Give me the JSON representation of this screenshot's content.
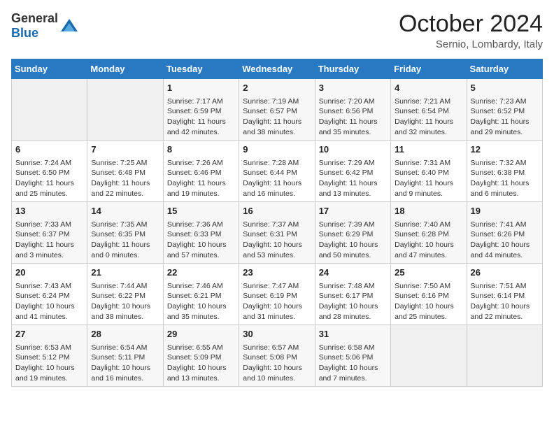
{
  "header": {
    "logo_general": "General",
    "logo_blue": "Blue",
    "month": "October 2024",
    "location": "Sernio, Lombardy, Italy"
  },
  "weekdays": [
    "Sunday",
    "Monday",
    "Tuesday",
    "Wednesday",
    "Thursday",
    "Friday",
    "Saturday"
  ],
  "weeks": [
    [
      {
        "day": "",
        "sunrise": "",
        "sunset": "",
        "daylight": ""
      },
      {
        "day": "",
        "sunrise": "",
        "sunset": "",
        "daylight": ""
      },
      {
        "day": "1",
        "sunrise": "Sunrise: 7:17 AM",
        "sunset": "Sunset: 6:59 PM",
        "daylight": "Daylight: 11 hours and 42 minutes."
      },
      {
        "day": "2",
        "sunrise": "Sunrise: 7:19 AM",
        "sunset": "Sunset: 6:57 PM",
        "daylight": "Daylight: 11 hours and 38 minutes."
      },
      {
        "day": "3",
        "sunrise": "Sunrise: 7:20 AM",
        "sunset": "Sunset: 6:56 PM",
        "daylight": "Daylight: 11 hours and 35 minutes."
      },
      {
        "day": "4",
        "sunrise": "Sunrise: 7:21 AM",
        "sunset": "Sunset: 6:54 PM",
        "daylight": "Daylight: 11 hours and 32 minutes."
      },
      {
        "day": "5",
        "sunrise": "Sunrise: 7:23 AM",
        "sunset": "Sunset: 6:52 PM",
        "daylight": "Daylight: 11 hours and 29 minutes."
      }
    ],
    [
      {
        "day": "6",
        "sunrise": "Sunrise: 7:24 AM",
        "sunset": "Sunset: 6:50 PM",
        "daylight": "Daylight: 11 hours and 25 minutes."
      },
      {
        "day": "7",
        "sunrise": "Sunrise: 7:25 AM",
        "sunset": "Sunset: 6:48 PM",
        "daylight": "Daylight: 11 hours and 22 minutes."
      },
      {
        "day": "8",
        "sunrise": "Sunrise: 7:26 AM",
        "sunset": "Sunset: 6:46 PM",
        "daylight": "Daylight: 11 hours and 19 minutes."
      },
      {
        "day": "9",
        "sunrise": "Sunrise: 7:28 AM",
        "sunset": "Sunset: 6:44 PM",
        "daylight": "Daylight: 11 hours and 16 minutes."
      },
      {
        "day": "10",
        "sunrise": "Sunrise: 7:29 AM",
        "sunset": "Sunset: 6:42 PM",
        "daylight": "Daylight: 11 hours and 13 minutes."
      },
      {
        "day": "11",
        "sunrise": "Sunrise: 7:31 AM",
        "sunset": "Sunset: 6:40 PM",
        "daylight": "Daylight: 11 hours and 9 minutes."
      },
      {
        "day": "12",
        "sunrise": "Sunrise: 7:32 AM",
        "sunset": "Sunset: 6:38 PM",
        "daylight": "Daylight: 11 hours and 6 minutes."
      }
    ],
    [
      {
        "day": "13",
        "sunrise": "Sunrise: 7:33 AM",
        "sunset": "Sunset: 6:37 PM",
        "daylight": "Daylight: 11 hours and 3 minutes."
      },
      {
        "day": "14",
        "sunrise": "Sunrise: 7:35 AM",
        "sunset": "Sunset: 6:35 PM",
        "daylight": "Daylight: 11 hours and 0 minutes."
      },
      {
        "day": "15",
        "sunrise": "Sunrise: 7:36 AM",
        "sunset": "Sunset: 6:33 PM",
        "daylight": "Daylight: 10 hours and 57 minutes."
      },
      {
        "day": "16",
        "sunrise": "Sunrise: 7:37 AM",
        "sunset": "Sunset: 6:31 PM",
        "daylight": "Daylight: 10 hours and 53 minutes."
      },
      {
        "day": "17",
        "sunrise": "Sunrise: 7:39 AM",
        "sunset": "Sunset: 6:29 PM",
        "daylight": "Daylight: 10 hours and 50 minutes."
      },
      {
        "day": "18",
        "sunrise": "Sunrise: 7:40 AM",
        "sunset": "Sunset: 6:28 PM",
        "daylight": "Daylight: 10 hours and 47 minutes."
      },
      {
        "day": "19",
        "sunrise": "Sunrise: 7:41 AM",
        "sunset": "Sunset: 6:26 PM",
        "daylight": "Daylight: 10 hours and 44 minutes."
      }
    ],
    [
      {
        "day": "20",
        "sunrise": "Sunrise: 7:43 AM",
        "sunset": "Sunset: 6:24 PM",
        "daylight": "Daylight: 10 hours and 41 minutes."
      },
      {
        "day": "21",
        "sunrise": "Sunrise: 7:44 AM",
        "sunset": "Sunset: 6:22 PM",
        "daylight": "Daylight: 10 hours and 38 minutes."
      },
      {
        "day": "22",
        "sunrise": "Sunrise: 7:46 AM",
        "sunset": "Sunset: 6:21 PM",
        "daylight": "Daylight: 10 hours and 35 minutes."
      },
      {
        "day": "23",
        "sunrise": "Sunrise: 7:47 AM",
        "sunset": "Sunset: 6:19 PM",
        "daylight": "Daylight: 10 hours and 31 minutes."
      },
      {
        "day": "24",
        "sunrise": "Sunrise: 7:48 AM",
        "sunset": "Sunset: 6:17 PM",
        "daylight": "Daylight: 10 hours and 28 minutes."
      },
      {
        "day": "25",
        "sunrise": "Sunrise: 7:50 AM",
        "sunset": "Sunset: 6:16 PM",
        "daylight": "Daylight: 10 hours and 25 minutes."
      },
      {
        "day": "26",
        "sunrise": "Sunrise: 7:51 AM",
        "sunset": "Sunset: 6:14 PM",
        "daylight": "Daylight: 10 hours and 22 minutes."
      }
    ],
    [
      {
        "day": "27",
        "sunrise": "Sunrise: 6:53 AM",
        "sunset": "Sunset: 5:12 PM",
        "daylight": "Daylight: 10 hours and 19 minutes."
      },
      {
        "day": "28",
        "sunrise": "Sunrise: 6:54 AM",
        "sunset": "Sunset: 5:11 PM",
        "daylight": "Daylight: 10 hours and 16 minutes."
      },
      {
        "day": "29",
        "sunrise": "Sunrise: 6:55 AM",
        "sunset": "Sunset: 5:09 PM",
        "daylight": "Daylight: 10 hours and 13 minutes."
      },
      {
        "day": "30",
        "sunrise": "Sunrise: 6:57 AM",
        "sunset": "Sunset: 5:08 PM",
        "daylight": "Daylight: 10 hours and 10 minutes."
      },
      {
        "day": "31",
        "sunrise": "Sunrise: 6:58 AM",
        "sunset": "Sunset: 5:06 PM",
        "daylight": "Daylight: 10 hours and 7 minutes."
      },
      {
        "day": "",
        "sunrise": "",
        "sunset": "",
        "daylight": ""
      },
      {
        "day": "",
        "sunrise": "",
        "sunset": "",
        "daylight": ""
      }
    ]
  ]
}
